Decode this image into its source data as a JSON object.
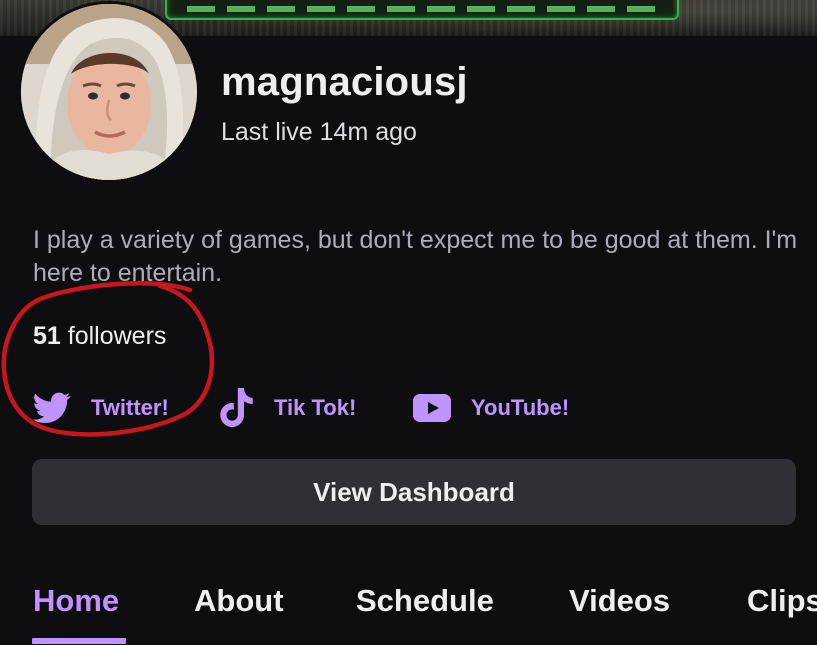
{
  "profile": {
    "username": "magnaciousj",
    "last_live": "Last live 14m ago",
    "bio": "I play a variety of games, but don't expect me to be good at them. I'm here to entertain.",
    "followers_count": "51",
    "followers_label": "followers"
  },
  "social_links": [
    {
      "label": "Twitter!",
      "icon": "twitter-bird-icon"
    },
    {
      "label": "Tik Tok!",
      "icon": "tiktok-note-icon"
    },
    {
      "label": "YouTube!",
      "icon": "youtube-play-icon"
    }
  ],
  "dashboard_button": {
    "label": "View Dashboard"
  },
  "tabs": [
    {
      "label": "Home",
      "active": true
    },
    {
      "label": "About",
      "active": false
    },
    {
      "label": "Schedule",
      "active": false
    },
    {
      "label": "Videos",
      "active": false
    },
    {
      "label": "Clips",
      "active": false
    }
  ],
  "colors": {
    "background": "#0e0e10",
    "accent": "#bf94ff",
    "button_bg": "#2f2f35",
    "muted_text": "#adadb8",
    "annotation_red": "#c8171c"
  }
}
